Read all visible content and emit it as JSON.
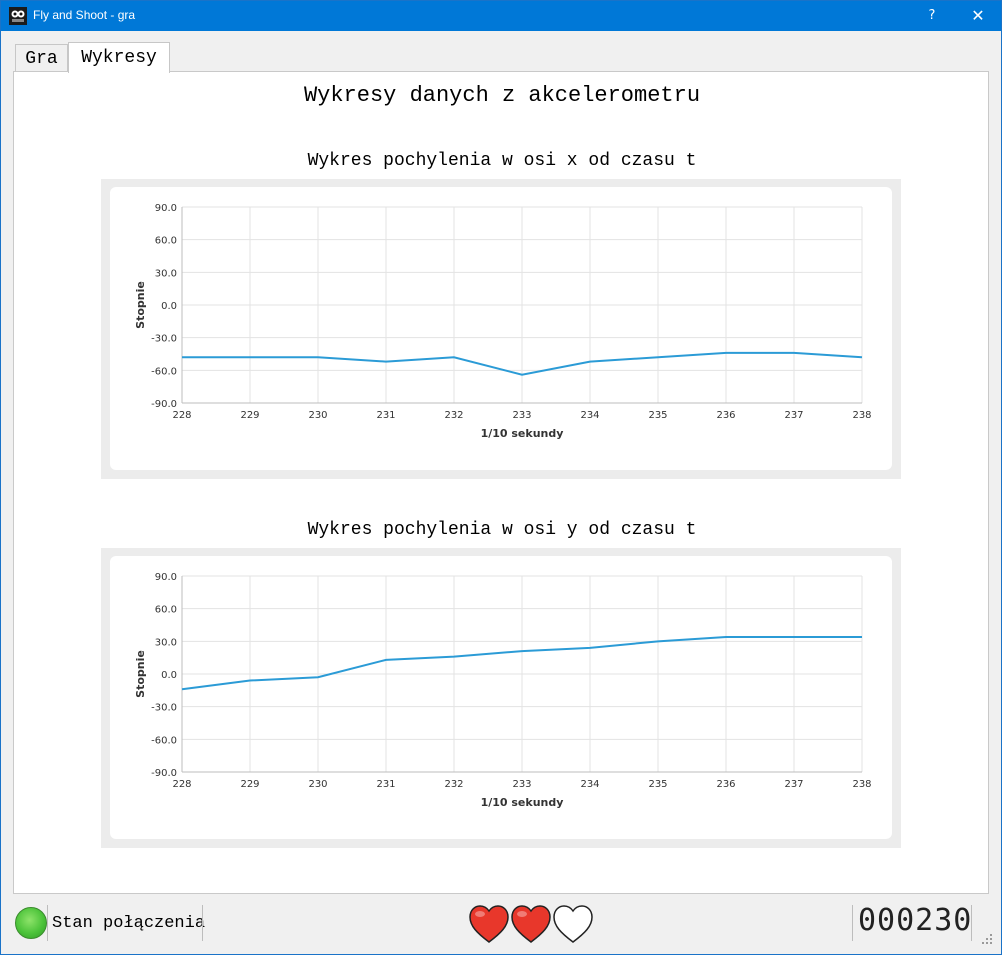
{
  "window": {
    "title": "Fly and Shoot - gra",
    "help_label": "?",
    "close_label": "✕"
  },
  "tabs": [
    {
      "label": "Gra",
      "active": false
    },
    {
      "label": "Wykresy",
      "active": true
    }
  ],
  "page": {
    "title": "Wykresy danych z akcelerometru"
  },
  "chart_data": [
    {
      "type": "line",
      "title": "Wykres pochylenia w osi x od czasu t",
      "xlabel": "1/10 sekundy",
      "ylabel": "Stopnie",
      "x": [
        228,
        229,
        230,
        231,
        232,
        233,
        234,
        235,
        236,
        237,
        238
      ],
      "y": [
        -48,
        -48,
        -48,
        -52,
        -48,
        -64,
        -52,
        -48,
        -44,
        -44,
        -48
      ],
      "xlim": [
        228,
        238
      ],
      "ylim": [
        -90,
        90
      ],
      "yticks": [
        "90.0",
        "60.0",
        "30.0",
        "0.0",
        "-30.0",
        "-60.0",
        "-90.0"
      ],
      "xticks": [
        "228",
        "229",
        "230",
        "231",
        "232",
        "233",
        "234",
        "235",
        "236",
        "237",
        "238"
      ],
      "grid": true,
      "color": "#2b9bd6"
    },
    {
      "type": "line",
      "title": "Wykres pochylenia w osi y od czasu t",
      "xlabel": "1/10 sekundy",
      "ylabel": "Stopnie",
      "x": [
        228,
        229,
        230,
        231,
        232,
        233,
        234,
        235,
        236,
        237,
        238
      ],
      "y": [
        -14,
        -6,
        -3,
        13,
        16,
        21,
        24,
        30,
        34,
        34,
        34
      ],
      "xlim": [
        228,
        238
      ],
      "ylim": [
        -90,
        90
      ],
      "yticks": [
        "90.0",
        "60.0",
        "30.0",
        "0.0",
        "-30.0",
        "-60.0",
        "-90.0"
      ],
      "xticks": [
        "228",
        "229",
        "230",
        "231",
        "232",
        "233",
        "234",
        "235",
        "236",
        "237",
        "238"
      ],
      "grid": true,
      "color": "#2b9bd6"
    }
  ],
  "status": {
    "connection_label": "Stan połączenia",
    "connection_color": "#4cc33a",
    "lives_total": 3,
    "lives_remaining": 2,
    "heart_color": "#e8372b",
    "score": "000230"
  }
}
